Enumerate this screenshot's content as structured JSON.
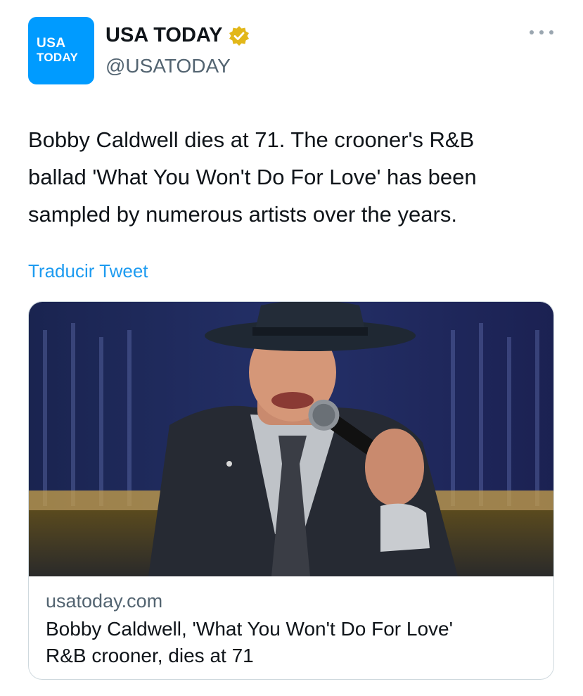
{
  "author": {
    "avatar_line1": "USA",
    "avatar_line2": "TODAY",
    "display_name": "USA TODAY",
    "handle": "@USATODAY",
    "verified_icon": "gold-verified-badge-icon",
    "avatar_color": "#009bff"
  },
  "tweet": {
    "text": "Bobby Caldwell dies at 71. The crooner's R&B\nballad 'What You Won't Do For Love' has been\nsampled by numerous artists over the years.",
    "translate_label": "Traducir Tweet"
  },
  "link_card": {
    "domain": "usatoday.com",
    "title": "Bobby Caldwell, 'What You Won't Do For Love'\nR&B crooner, dies at 71"
  },
  "colors": {
    "link": "#1d9bf0",
    "secondary_text": "#536471",
    "badge": "#e2b719"
  }
}
